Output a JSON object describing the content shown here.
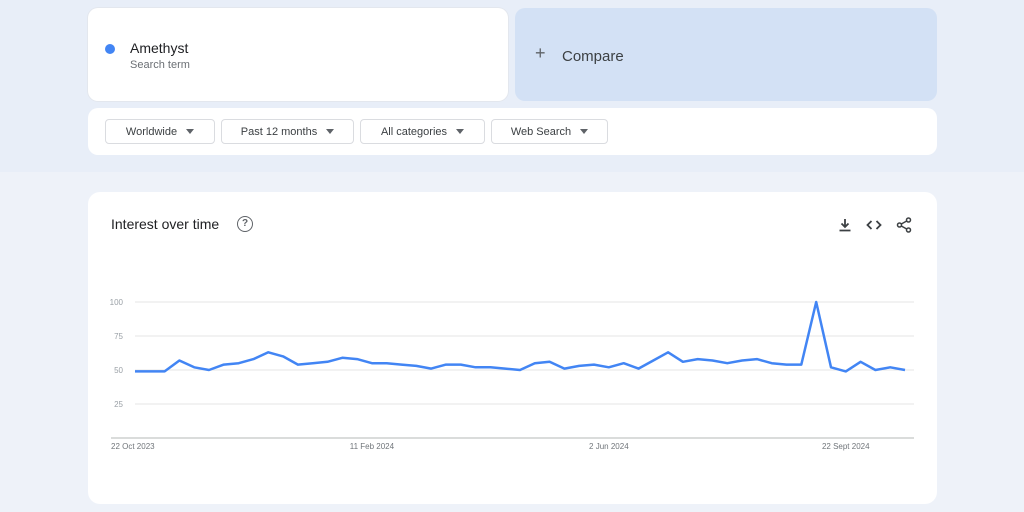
{
  "search_term": {
    "name": "Amethyst",
    "subtitle": "Search term",
    "color": "#4285f4"
  },
  "compare": {
    "label": "Compare"
  },
  "filters": {
    "region": "Worldwide",
    "time": "Past 12 months",
    "category": "All categories",
    "property": "Web Search"
  },
  "interest_panel": {
    "title": "Interest over time",
    "icons": [
      "help-icon",
      "download-icon",
      "embed-icon",
      "share-icon"
    ]
  },
  "chart_data": {
    "type": "line",
    "ylim": [
      0,
      100
    ],
    "yticks": [
      25,
      50,
      75,
      100
    ],
    "xtick_labels": [
      "22 Oct 2023",
      "11 Feb 2024",
      "2 Jun 2024",
      "22 Sept 2024"
    ],
    "xtick_index": [
      0,
      16,
      32,
      48
    ],
    "grid": true,
    "series": [
      {
        "color": "#4285f4",
        "values": [
          49,
          49,
          49,
          57,
          52,
          50,
          54,
          55,
          58,
          63,
          60,
          54,
          55,
          56,
          59,
          58,
          55,
          55,
          54,
          53,
          51,
          54,
          54,
          52,
          52,
          51,
          50,
          55,
          56,
          51,
          53,
          54,
          52,
          55,
          51,
          57,
          63,
          56,
          58,
          57,
          55,
          57,
          58,
          55,
          54,
          54,
          100,
          52,
          49,
          56,
          50,
          52,
          50
        ]
      }
    ]
  }
}
